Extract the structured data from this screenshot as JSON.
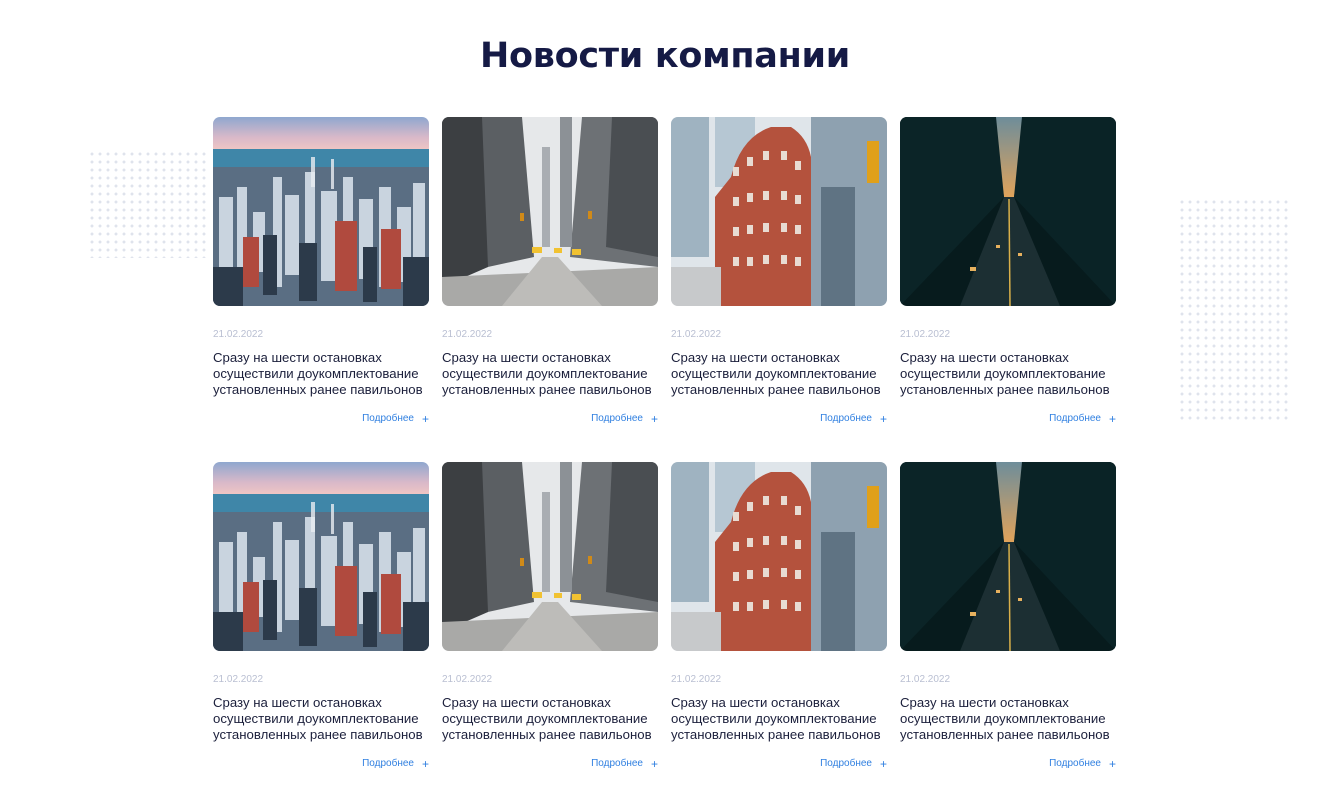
{
  "section": {
    "title": "Новости компании"
  },
  "news": [
    {
      "image": "skyline-chicago",
      "date": "21.02.2022",
      "lines": [
        "Сразу на шести остановках",
        "осуществили доукомплектование",
        "установленных ранее павильонов"
      ],
      "more_label": "Подробнее",
      "more_icon": "plus-icon"
    },
    {
      "image": "city-street",
      "date": "21.02.2022",
      "lines": [
        "Сразу на шести остановках",
        "осуществили доукомплектование",
        "установленных ранее павильонов"
      ],
      "more_label": "Подробнее",
      "more_icon": "plus-icon"
    },
    {
      "image": "flatiron-building",
      "date": "21.02.2022",
      "lines": [
        "Сразу на шести остановках",
        "осуществили доукомплектование",
        "установленных ранее павильонов"
      ],
      "more_label": "Подробнее",
      "more_icon": "plus-icon"
    },
    {
      "image": "dark-avenue-sunset",
      "date": "21.02.2022",
      "lines": [
        "Сразу на шести остановках",
        "осуществили доукомплектование",
        "установленных ранее павильонов"
      ],
      "more_label": "Подробнее",
      "more_icon": "plus-icon"
    },
    {
      "image": "skyline-chicago",
      "date": "21.02.2022",
      "lines": [
        "Сразу на шести остановках",
        "осуществили доукомплектование",
        "установленных ранее павильонов"
      ],
      "more_label": "Подробнее",
      "more_icon": "plus-icon"
    },
    {
      "image": "city-street",
      "date": "21.02.2022",
      "lines": [
        "Сразу на шести остановках",
        "осуществили доукомплектование",
        "установленных ранее павильонов"
      ],
      "more_label": "Подробнее",
      "more_icon": "plus-icon"
    },
    {
      "image": "flatiron-building",
      "date": "21.02.2022",
      "lines": [
        "Сразу на шести остановках",
        "осуществили доукомплектование",
        "установленных ранее павильонов"
      ],
      "more_label": "Подробнее",
      "more_icon": "plus-icon"
    },
    {
      "image": "dark-avenue-sunset",
      "date": "21.02.2022",
      "lines": [
        "Сразу на шести остановках",
        "осуществили доукомплектование",
        "установленных ранее павильонов"
      ],
      "more_label": "Подробнее",
      "more_icon": "plus-icon"
    }
  ],
  "colors": {
    "title": "#151a45",
    "date": "#b9bfd2",
    "text": "#1b1f3b",
    "link": "#2f7fe0"
  }
}
